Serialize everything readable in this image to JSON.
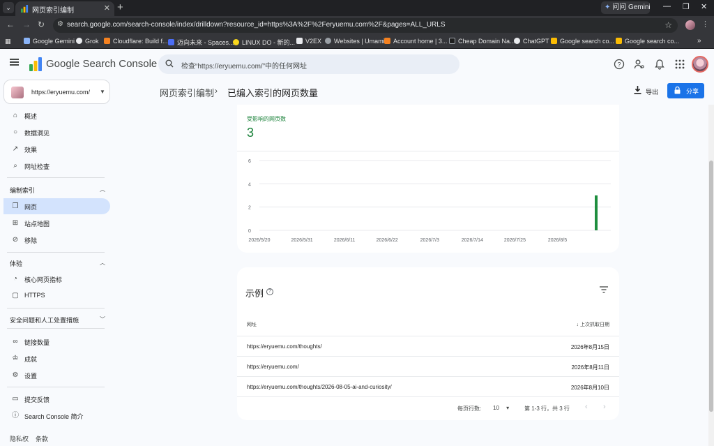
{
  "browser": {
    "tab_title": "网页索引编制",
    "gemini_label": "问问 Gemini",
    "url": "search.google.com/search-console/index/drilldown?resource_id=https%3A%2F%2Feryuemu.com%2F&pages=ALL_URLS",
    "bookmarks": [
      {
        "label": "Google Gemini",
        "color": "#8ab4f8"
      },
      {
        "label": "Grok",
        "color": "#e8eaed"
      },
      {
        "label": "Cloudflare: Build f...",
        "color": "#f48120"
      },
      {
        "label": "迈向未来 - Spaces...",
        "color": "#4c6ef5"
      },
      {
        "label": "LINUX DO - 新的...",
        "color": "#f9d71c"
      },
      {
        "label": "V2EX",
        "color": "#e8eaed"
      },
      {
        "label": "Websites | Umami",
        "color": "#9aa0a6"
      },
      {
        "label": "Account home | 3...",
        "color": "#f48120"
      },
      {
        "label": "Cheap Domain Na...",
        "color": "#1f1f1f"
      },
      {
        "label": "ChatGPT",
        "color": "#e8eaed"
      },
      {
        "label": "Google search co...",
        "color": "#fbbc04"
      },
      {
        "label": "Google search co...",
        "color": "#fbbc04"
      }
    ],
    "bookmarks_more": "»"
  },
  "header": {
    "product_name": "Google Search Console",
    "search_placeholder": "检查“https://eryuemu.com/”中的任何网址"
  },
  "property": {
    "url": "https://eryuemu.com/"
  },
  "nav": {
    "top_items": [
      {
        "label": "概述",
        "icon": "home-icon"
      },
      {
        "label": "数据洞见",
        "icon": "lightbulb-icon"
      },
      {
        "label": "效果",
        "icon": "trending-icon"
      },
      {
        "label": "网址检查",
        "icon": "search-icon"
      }
    ],
    "section_index": "编制索引",
    "index_items": [
      {
        "label": "网页",
        "icon": "pages-icon"
      },
      {
        "label": "站点地图",
        "icon": "sitemap-icon"
      },
      {
        "label": "移除",
        "icon": "visibility-off-icon"
      }
    ],
    "section_experience": "体验",
    "experience_items": [
      {
        "label": "核心网页指标",
        "icon": "speed-icon"
      },
      {
        "label": "HTTPS",
        "icon": "lock-icon"
      }
    ],
    "section_security": "安全问题和人工处置措施",
    "other_items": [
      {
        "label": "链接数量",
        "icon": "link-icon"
      },
      {
        "label": "成就",
        "icon": "trophy-icon"
      },
      {
        "label": "设置",
        "icon": "gear-icon"
      }
    ],
    "bottom_items": [
      {
        "label": "提交反馈",
        "icon": "feedback-icon"
      },
      {
        "label": "Search Console 简介",
        "icon": "info-icon"
      }
    ],
    "footer": [
      "隐私权",
      "条款"
    ]
  },
  "page": {
    "breadcrumb_parent": "网页索引编制",
    "breadcrumb_sep": "›",
    "breadcrumb_current": "已编入索引的网页数量",
    "export_label": "导出",
    "share_label": "分享"
  },
  "metric": {
    "label": "受影响的网页数",
    "value": "3"
  },
  "chart_data": {
    "type": "bar",
    "ylim": [
      0,
      6
    ],
    "yticks": [
      "0",
      "2",
      "4",
      "6"
    ],
    "xticks": [
      "2026/5/20",
      "2026/5/31",
      "2026/6/11",
      "2026/6/22",
      "2026/7/3",
      "2026/7/14",
      "2026/7/25",
      "2026/8/5"
    ],
    "start_date": "2026-05-20",
    "end_date": "2026-08-15",
    "bars": [
      {
        "date": "2026-08-15",
        "value": 3
      }
    ],
    "bar_color": "#1e8e3e"
  },
  "table": {
    "title": "示例",
    "col_url": "网址",
    "col_date": "上次抓取日期",
    "sort_arrow": "↓",
    "rows": [
      {
        "url": "https://eryuemu.com/thoughts/",
        "date": "2026年8月15日"
      },
      {
        "url": "https://eryuemu.com/",
        "date": "2026年8月11日"
      },
      {
        "url": "https://eryuemu.com/thoughts/2026-08-05-ai-and-curiosity/",
        "date": "2026年8月10日"
      }
    ],
    "rows_per_page_label": "每页行数:",
    "rows_per_page_value": "10",
    "range_text": "第 1-3 行，共 3 行"
  }
}
